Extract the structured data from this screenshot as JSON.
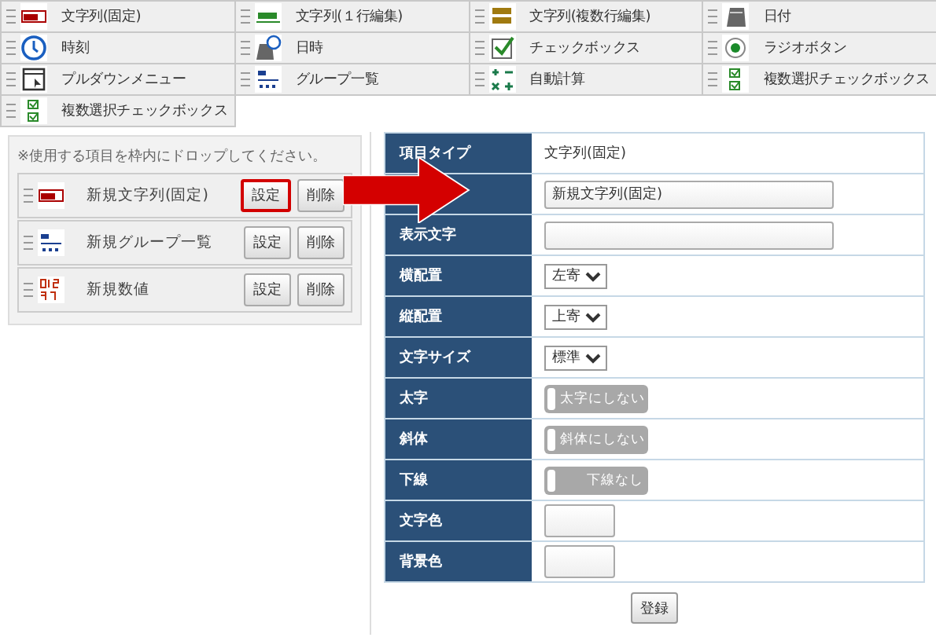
{
  "palette": [
    {
      "kind": "text-fixed",
      "label": "文字列(固定)"
    },
    {
      "kind": "text-line",
      "label": "文字列(１行編集)"
    },
    {
      "kind": "text-multi",
      "label": "文字列(複数行編集)"
    },
    {
      "kind": "calendar",
      "label": "日付"
    },
    {
      "kind": "clock",
      "label": "時刻"
    },
    {
      "kind": "datetime",
      "label": "日時"
    },
    {
      "kind": "checkbox",
      "label": "チェックボックス"
    },
    {
      "kind": "radio",
      "label": "ラジオボタン"
    },
    {
      "kind": "dropdown",
      "label": "プルダウンメニュー"
    },
    {
      "kind": "group",
      "label": "グループ一覧"
    },
    {
      "kind": "calc",
      "label": "自動計算"
    },
    {
      "kind": "multicheck",
      "label": "複数選択チェックボックス"
    },
    {
      "kind": "multicheck",
      "label": "複数選択チェックボックス"
    }
  ],
  "drop_area": {
    "hint": "※使用する項目を枠内にドロップしてください。",
    "items": [
      {
        "kind": "text-fixed",
        "name": "新規文字列(固定)",
        "settings": "設定",
        "delete": "削除",
        "highlighted": true
      },
      {
        "kind": "group",
        "name": "新規グループ一覧",
        "settings": "設定",
        "delete": "削除",
        "highlighted": false
      },
      {
        "kind": "number",
        "name": "新規数値",
        "settings": "設定",
        "delete": "削除",
        "highlighted": false
      }
    ]
  },
  "form": {
    "rows": [
      {
        "kind": "text",
        "label": "項目タイプ",
        "value": "文字列(固定)"
      },
      {
        "kind": "input",
        "value": "新規文字列(固定)"
      },
      {
        "kind": "input",
        "label": "表示文字"
      },
      {
        "kind": "select",
        "label": "横配置",
        "value": "左寄"
      },
      {
        "kind": "select",
        "label": "縦配置",
        "value": "上寄"
      },
      {
        "kind": "select",
        "label": "文字サイズ",
        "value": "標準"
      },
      {
        "kind": "toggle",
        "label": "太字",
        "value": "太字にしない",
        "on": false
      },
      {
        "kind": "toggle",
        "label": "斜体",
        "value": "斜体にしない",
        "on": false
      },
      {
        "kind": "toggle",
        "label": "下線",
        "value": "下線なし",
        "on": false
      },
      {
        "kind": "color",
        "label": "文字色"
      },
      {
        "kind": "color",
        "label": "背景色"
      }
    ],
    "submit": "登録"
  }
}
